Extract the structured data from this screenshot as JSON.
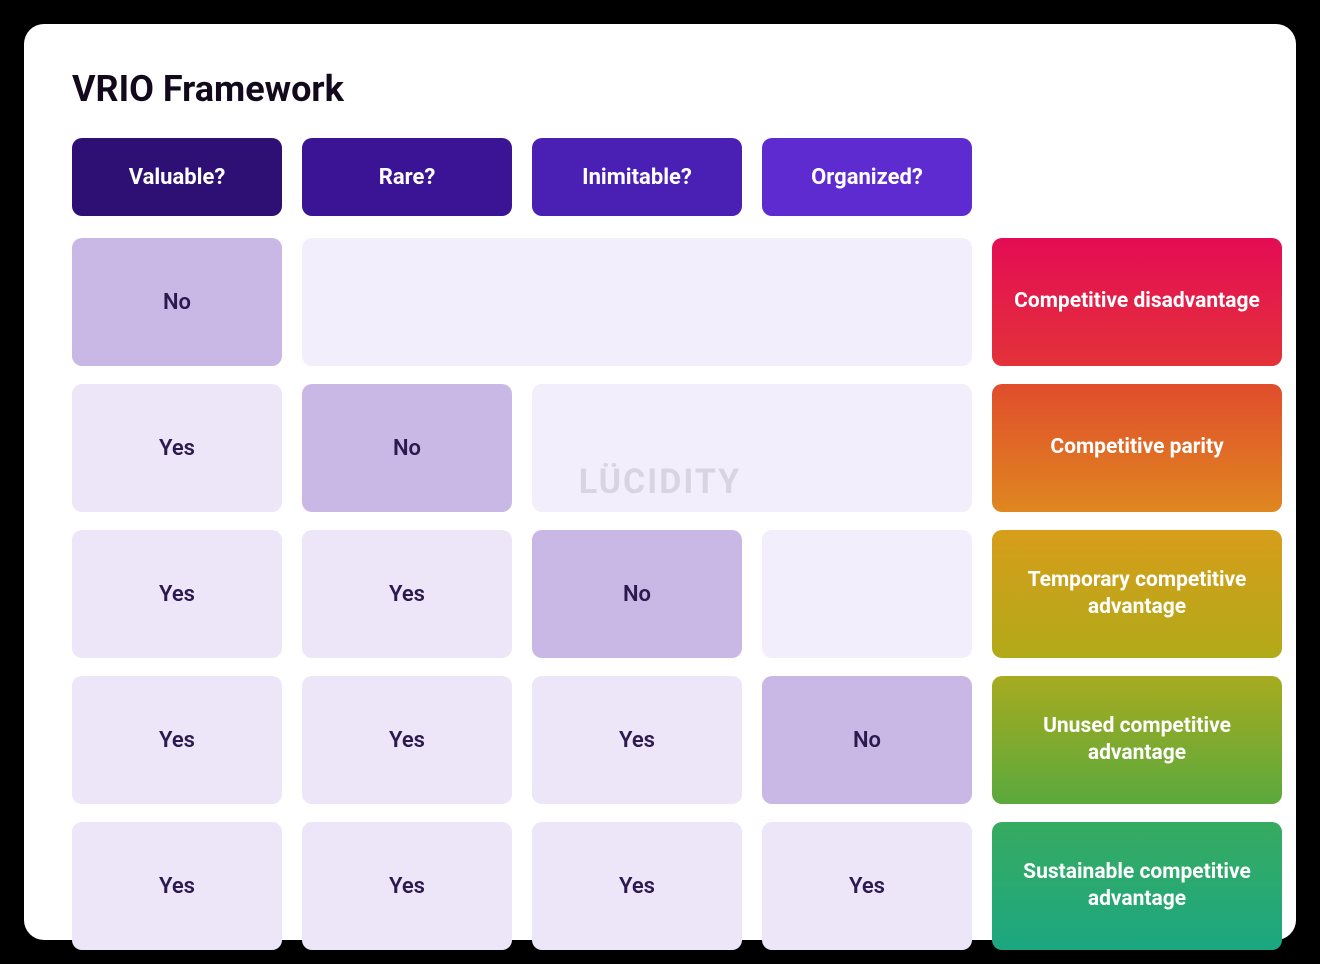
{
  "title": "VRIO Framework",
  "watermark": "LÜCIDITY",
  "headers": [
    {
      "label": "Valuable?",
      "bg": "#2e0f73"
    },
    {
      "label": "Rare?",
      "bg": "#3a1494"
    },
    {
      "label": "Inimitable?",
      "bg": "#4a1fb3"
    },
    {
      "label": "Organized?",
      "bg": "#5e2bd1"
    }
  ],
  "labels": {
    "yes": "Yes",
    "no": "No"
  },
  "rows": [
    {
      "cells": [
        "no",
        "blank",
        "blank",
        "blank"
      ],
      "merge_blank_from": 1,
      "outcome": {
        "label": "Competitive disadvantage",
        "gradient": "linear-gradient(180deg,#e40c55 0%,#e33239 100%)"
      }
    },
    {
      "cells": [
        "yes",
        "no",
        "blank",
        "blank"
      ],
      "merge_blank_from": 2,
      "outcome": {
        "label": "Competitive parity",
        "gradient": "linear-gradient(180deg,#e04d2c 0%,#df8720 100%)"
      }
    },
    {
      "cells": [
        "yes",
        "yes",
        "no",
        "blank"
      ],
      "merge_blank_from": 3,
      "outcome": {
        "label": "Temporary competitive advantage",
        "gradient": "linear-gradient(180deg,#d79d1b 0%,#b1aa18 100%)"
      }
    },
    {
      "cells": [
        "yes",
        "yes",
        "yes",
        "no"
      ],
      "merge_blank_from": null,
      "outcome": {
        "label": "Unused competitive advantage",
        "gradient": "linear-gradient(180deg,#a7ab1f 0%,#5aa93d 100%)"
      }
    },
    {
      "cells": [
        "yes",
        "yes",
        "yes",
        "yes"
      ],
      "merge_blank_from": null,
      "outcome": {
        "label": "Sustainable competitive advantage",
        "gradient": "linear-gradient(180deg,#37ab60 0%,#1ca781 100%)"
      }
    }
  ]
}
